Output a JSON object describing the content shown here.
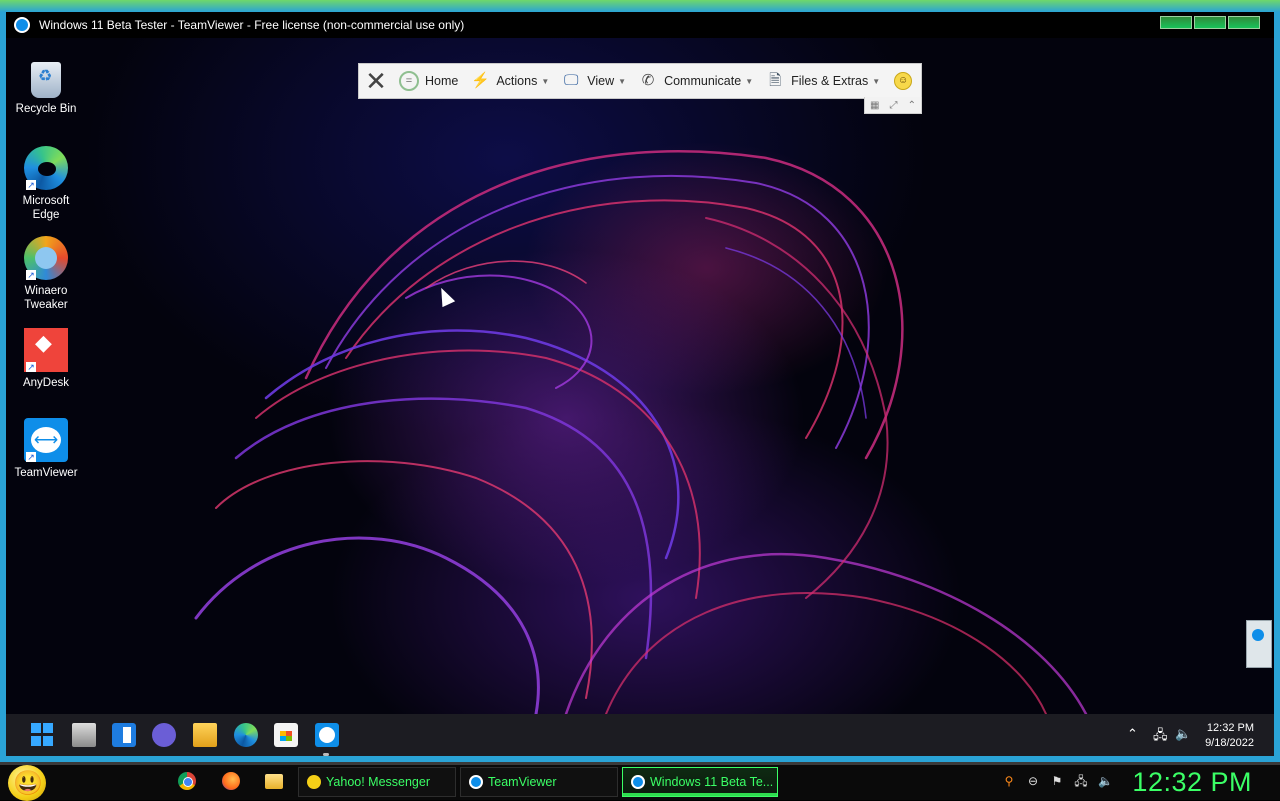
{
  "window": {
    "title": "Windows 11 Beta Tester - TeamViewer - Free license (non-commercial use only)"
  },
  "desktop_icons": [
    {
      "label": "Recycle Bin",
      "icon": "recycle-bin-icon"
    },
    {
      "label": "Microsoft Edge",
      "icon": "edge-icon"
    },
    {
      "label": "Winaero Tweaker",
      "icon": "winaero-tweaker-icon"
    },
    {
      "label": "AnyDesk",
      "icon": "anydesk-icon"
    },
    {
      "label": "TeamViewer",
      "icon": "teamviewer-icon"
    }
  ],
  "toolbar": {
    "home": "Home",
    "actions": "Actions",
    "view": "View",
    "communicate": "Communicate",
    "files_extras": "Files & Extras"
  },
  "remote_taskbar": {
    "time": "12:32 PM",
    "date": "9/18/2022"
  },
  "host_taskbar": {
    "tasks": [
      {
        "label": "Yahoo! Messenger"
      },
      {
        "label": "TeamViewer"
      },
      {
        "label": "Windows 11 Beta Te..."
      }
    ],
    "clock": "12:32 PM"
  },
  "colors": {
    "host_frame": "#2aa3d6",
    "host_text_green": "#3bff66",
    "teamviewer_blue": "#0e8ee9",
    "remote_taskbar": "#1c1c22"
  }
}
